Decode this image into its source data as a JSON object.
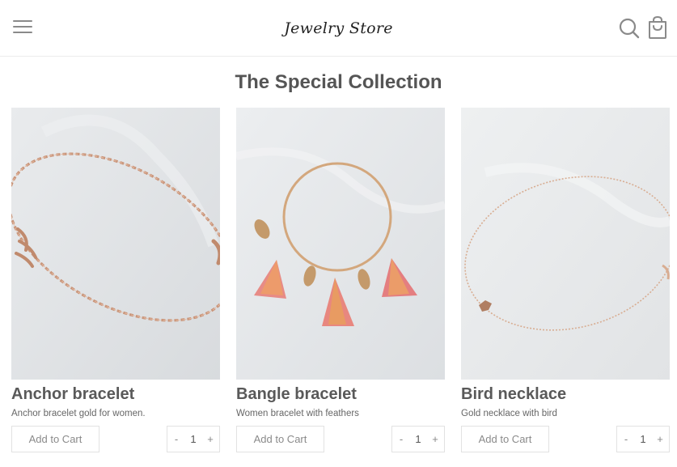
{
  "header": {
    "brand": "Jewelry Store",
    "menu_icon": "hamburger-menu-icon",
    "search_icon": "search-icon",
    "cart_icon": "shopping-bag-icon"
  },
  "main": {
    "title": "The Special Collection"
  },
  "products": [
    {
      "name": "Anchor bracelet",
      "description": "Anchor bracelet gold for women.",
      "add_label": "Add to Cart",
      "quantity": "1",
      "minus": "-",
      "plus": "+"
    },
    {
      "name": "Bangle bracelet",
      "description": "Women bracelet with feathers",
      "add_label": "Add to Cart",
      "quantity": "1",
      "minus": "-",
      "plus": "+"
    },
    {
      "name": "Bird necklace",
      "description": "Gold necklace with bird",
      "add_label": "Add to Cart",
      "quantity": "1",
      "minus": "-",
      "plus": "+"
    }
  ],
  "colors": {
    "text": "#555555",
    "border": "#e2e2e2",
    "jewelry_gold": "#c9957a"
  }
}
